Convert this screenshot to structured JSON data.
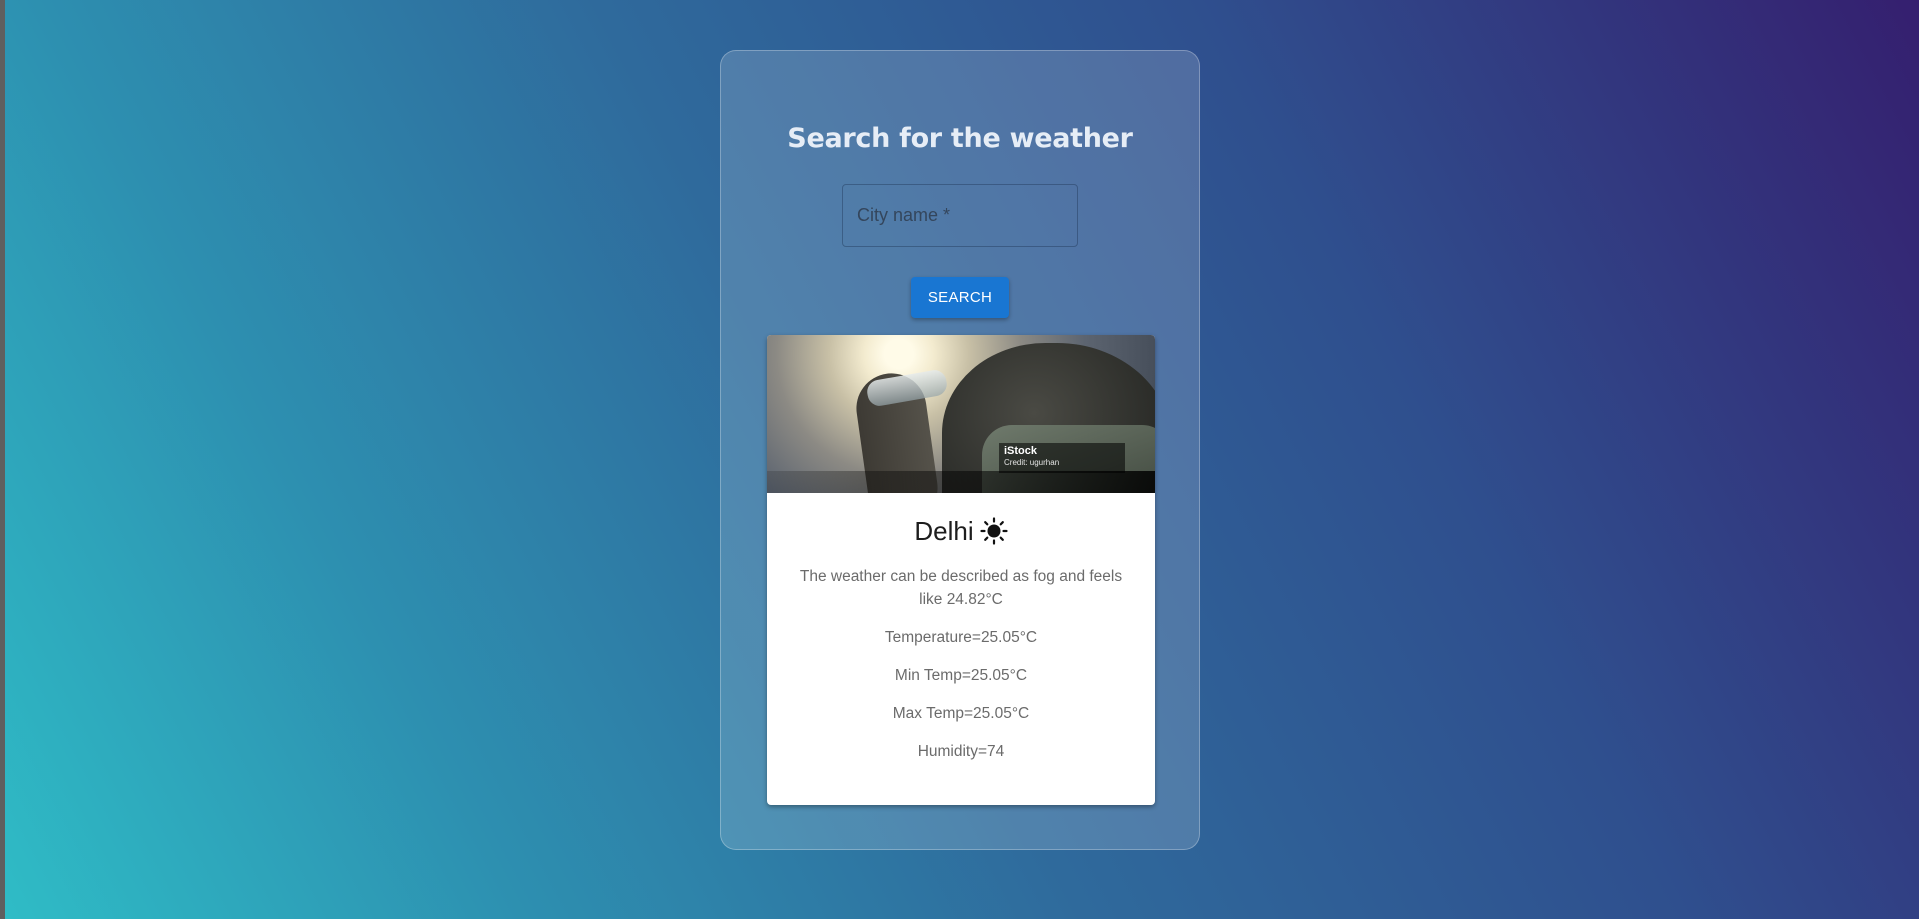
{
  "form": {
    "title": "Search for the weather",
    "city_placeholder": "City name *",
    "city_value": "",
    "search_label": "SEARCH"
  },
  "card": {
    "image": {
      "credit_logo": "iStock",
      "credit_text": "Credit: ugurhan"
    },
    "city": "Delhi",
    "weather_icon": "sun-icon",
    "description": "The weather can be described as fog and feels like 24.82°C",
    "temperature": "Temperature=25.05°C",
    "min_temp": "Min Temp=25.05°C",
    "max_temp": "Max Temp=25.05°C",
    "humidity": "Humidity=74"
  },
  "colors": {
    "button": "#1976d2",
    "background_start": "#2fbcc6",
    "background_end": "#351f6f"
  }
}
